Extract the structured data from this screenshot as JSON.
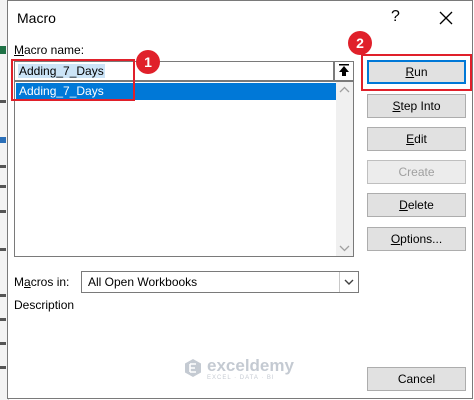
{
  "dialog": {
    "title": "Macro",
    "help": "?",
    "close_label": "close"
  },
  "macro_name_label": {
    "first": "M",
    "rest": "acro name:"
  },
  "macro_name_value": "Adding_7_Days",
  "macro_list": [
    "Adding_7_Days"
  ],
  "macros_in_label": {
    "pre": "M",
    "ul": "a",
    "post": "cros in:"
  },
  "macros_in_value": "All Open Workbooks",
  "description_label": {
    "pre": "D",
    "ul": "e",
    "post": "scription"
  },
  "buttons": [
    {
      "key": "run",
      "pre": "",
      "ul": "R",
      "post": "un",
      "disabled": false
    },
    {
      "key": "step-into",
      "pre": "",
      "ul": "S",
      "post": "tep Into",
      "disabled": false
    },
    {
      "key": "edit",
      "pre": "",
      "ul": "E",
      "post": "dit",
      "disabled": false
    },
    {
      "key": "create",
      "pre": "",
      "ul": "",
      "post": "Create",
      "disabled": true
    },
    {
      "key": "delete",
      "pre": "",
      "ul": "D",
      "post": "elete",
      "disabled": false
    },
    {
      "key": "options",
      "pre": "",
      "ul": "O",
      "post": "ptions...",
      "disabled": false
    },
    {
      "key": "cancel",
      "pre": "",
      "ul": "",
      "post": "Cancel",
      "disabled": false
    }
  ],
  "callouts": {
    "badge1": "1",
    "badge2": "2"
  },
  "watermark": {
    "name": "exceldemy",
    "sub": "EXCEL · DATA · BI"
  },
  "colors": {
    "accent": "#0078d7",
    "callout": "#e0202a",
    "selection": "#cce4f7"
  },
  "icons": {
    "upload": "upload-arrow-icon",
    "close": "close-icon",
    "scroll_up": "scroll-up-arrow-icon",
    "scroll_down": "scroll-down-arrow-icon",
    "dropdown": "chevron-down-icon"
  }
}
